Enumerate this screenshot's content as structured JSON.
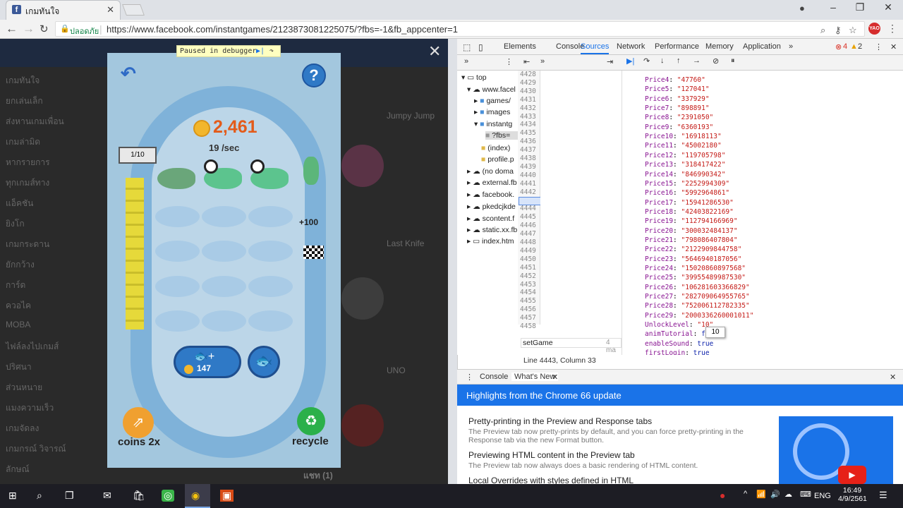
{
  "browser": {
    "tab_title": "เกมทันใจ",
    "tab_close": "✕",
    "security_label": "ปลอดภัย",
    "url": "https://www.facebook.com/instantgames/2123873081225075/?fbs=-1&fb_appcenter=1",
    "profile_badge": "YAO"
  },
  "fb_page": {
    "sidebar": [
      "เกมทันใจ",
      "ยกเล่นเล็ก",
      "ส่งหานเกมเพื่อน",
      "เกมล่ามิด",
      "หากรายการ",
      "ทุกเกมส์ทาง",
      "แอ็คชัน",
      "ยิงโก",
      "เกมกระดาน",
      "ยักกว้าง",
      "การ์ด",
      "ควอไค",
      "MOBA",
      "ไฟล์ลงไปเกมส์",
      "ปริศนา",
      "ส่วนหนาย",
      "แมงความเร็ว",
      "เกมจัดลง",
      "เกมกรณ์ วิจารณ์",
      "ลักษณ์"
    ],
    "cards": [
      "Jumpy Jump",
      "Last Knife",
      "UNO"
    ],
    "chat_label": "แชท (1)"
  },
  "debugger": {
    "paused": "Paused in debugger"
  },
  "game": {
    "coins": "2,461",
    "rate": "19 /sec",
    "level": "1/10",
    "bonus": "+100",
    "buy_cost": "147",
    "share_label": "coins 2x",
    "recycle_label": "recycle"
  },
  "devtools": {
    "tabs": [
      "Elements",
      "Console",
      "Sources",
      "Network",
      "Performance",
      "Memory",
      "Application"
    ],
    "errors": "4",
    "warnings": "2",
    "tree": [
      "top",
      "www.facel",
      "games/",
      "images",
      "instantg",
      "?fbs=",
      "(index)",
      "profile.p",
      "(no doma",
      "external.fb",
      "facebook.",
      "pkedcjkde",
      "scontent.f",
      "static.xx.fb",
      "index.htm"
    ],
    "line_numbers": [
      "4428",
      "4429",
      "4430",
      "4431",
      "4432",
      "4433",
      "4434",
      "4435",
      "4436",
      "4437",
      "4438",
      "4439",
      "4440",
      "4441",
      "4442",
      "4443",
      "4444",
      "4445",
      "4446",
      "4447",
      "4448",
      "4449",
      "4450",
      "4451",
      "4452",
      "4453",
      "4454",
      "4455",
      "4456",
      "4457",
      "4458"
    ],
    "scope": [
      {
        "k": "Price4",
        "v": "\"47760\""
      },
      {
        "k": "Price5",
        "v": "\"127041\""
      },
      {
        "k": "Price6",
        "v": "\"337929\""
      },
      {
        "k": "Price7",
        "v": "\"898891\""
      },
      {
        "k": "Price8",
        "v": "\"2391050\""
      },
      {
        "k": "Price9",
        "v": "\"6360193\""
      },
      {
        "k": "Price10",
        "v": "\"16918113\""
      },
      {
        "k": "Price11",
        "v": "\"45002180\""
      },
      {
        "k": "Price12",
        "v": "\"119705798\""
      },
      {
        "k": "Price13",
        "v": "\"318417422\""
      },
      {
        "k": "Price14",
        "v": "\"846990342\""
      },
      {
        "k": "Price15",
        "v": "\"2252994309\""
      },
      {
        "k": "Price16",
        "v": "\"5992964861\""
      },
      {
        "k": "Price17",
        "v": "\"15941286530\""
      },
      {
        "k": "Price18",
        "v": "\"42403822169\""
      },
      {
        "k": "Price19",
        "v": "\"112794166969\""
      },
      {
        "k": "Price20",
        "v": "\"300032484137\""
      },
      {
        "k": "Price21",
        "v": "\"798086407804\""
      },
      {
        "k": "Price22",
        "v": "\"2122909844758\""
      },
      {
        "k": "Price23",
        "v": "\"5646940187056\""
      },
      {
        "k": "Price24",
        "v": "\"15020860897568\""
      },
      {
        "k": "Price25",
        "v": "\"39955489987530\""
      },
      {
        "k": "Price26",
        "v": "\"106281603366829\""
      },
      {
        "k": "Price27",
        "v": "\"282709064955765\""
      },
      {
        "k": "Price28",
        "v": "\"752006112782335\""
      },
      {
        "k": "Price29",
        "v": "\"2000336260001011\""
      },
      {
        "k": "UnlockLevel",
        "v": "\"10\""
      },
      {
        "k": "animTutorial",
        "v": "false"
      },
      {
        "k": "enableSound",
        "v": "true"
      },
      {
        "k": "firstLogin",
        "v": "true"
      }
    ],
    "tooltip": "10",
    "search_value": "setGame",
    "status": "Line 4443, Column 33",
    "drawer_tabs": [
      "Console",
      "What's New"
    ],
    "banner": "Highlights from the Chrome 66 update",
    "news": [
      {
        "h": "Pretty-printing in the Preview and Response tabs",
        "d": "The Preview tab now pretty-prints by default, and you can force pretty-printing in the Response tab via the new Format button."
      },
      {
        "h": "Previewing HTML content in the Preview tab",
        "d": "The Preview tab now always does a basic rendering of HTML content."
      },
      {
        "h": "Local Overrides with styles defined in HTML",
        "d": ""
      }
    ]
  },
  "taskbar": {
    "lang": "ENG",
    "time": "16:49",
    "date": "4/9/2561"
  }
}
